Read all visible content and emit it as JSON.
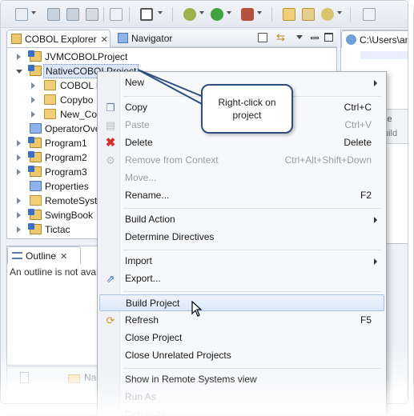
{
  "toolbar": {
    "icons": [
      "new-icon",
      "save-icon",
      "save-all-icon",
      "print-icon",
      "binary-icon",
      "window-icon",
      "debug-icon",
      "run-icon",
      "external-tools-icon",
      "open-folder-icon",
      "open-file-icon",
      "sync-icon",
      "back-icon"
    ]
  },
  "explorer": {
    "tab_label": "COBOL Explorer",
    "navigator_label": "Navigator",
    "items": [
      {
        "label": "JVMCOBOLProject"
      },
      {
        "label": "NativeCOBOLProject"
      },
      {
        "label": "COBOL P"
      },
      {
        "label": "Copybo"
      },
      {
        "label": "New_Cor"
      },
      {
        "label": "OperatorOve"
      },
      {
        "label": "Program1"
      },
      {
        "label": "Program2"
      },
      {
        "label": "Program3"
      },
      {
        "label": "Properties"
      },
      {
        "label": "RemoteSyste"
      },
      {
        "label": "SwingBook"
      },
      {
        "label": "Tictac"
      }
    ]
  },
  "editor": {
    "tab_label": "C:\\Users\\and",
    "fragment1": "le",
    "fragment2": "uild"
  },
  "outline": {
    "tab_label": "Outline",
    "message": "An outline is not avai"
  },
  "bottom": {
    "label": "Nat"
  },
  "context_menu": {
    "items": [
      {
        "label": "New",
        "shortcut": "",
        "submenu": true
      },
      {
        "label": "Copy",
        "shortcut": "Ctrl+C"
      },
      {
        "label": "Paste",
        "shortcut": "Ctrl+V",
        "disabled": true
      },
      {
        "label": "Delete",
        "shortcut": "Delete"
      },
      {
        "label": "Remove from Context",
        "shortcut": "Ctrl+Alt+Shift+Down",
        "disabled": true
      },
      {
        "label": "Move...",
        "shortcut": "",
        "disabled": true
      },
      {
        "label": "Rename...",
        "shortcut": "F2"
      },
      {
        "label": "Build Action",
        "shortcut": "",
        "submenu": true
      },
      {
        "label": "Determine Directives",
        "shortcut": ""
      },
      {
        "label": "Import",
        "shortcut": "",
        "submenu": true
      },
      {
        "label": "Export...",
        "shortcut": ""
      },
      {
        "label": "Build Project",
        "shortcut": "",
        "hover": true
      },
      {
        "label": "Refresh",
        "shortcut": "F5"
      },
      {
        "label": "Close Project",
        "shortcut": ""
      },
      {
        "label": "Close Unrelated Projects",
        "shortcut": ""
      },
      {
        "label": "Show in Remote Systems view",
        "shortcut": ""
      },
      {
        "label": "Run As",
        "shortcut": "",
        "disabled": true
      },
      {
        "label": "Debug As",
        "shortcut": "",
        "disabled": true
      }
    ]
  },
  "callout": {
    "text_line1": "Right-click on",
    "text_line2": "project"
  },
  "colors": {
    "accent": "#2d4e7e",
    "selection": "#dbe7f8",
    "delete_icon": "#d0302c"
  }
}
